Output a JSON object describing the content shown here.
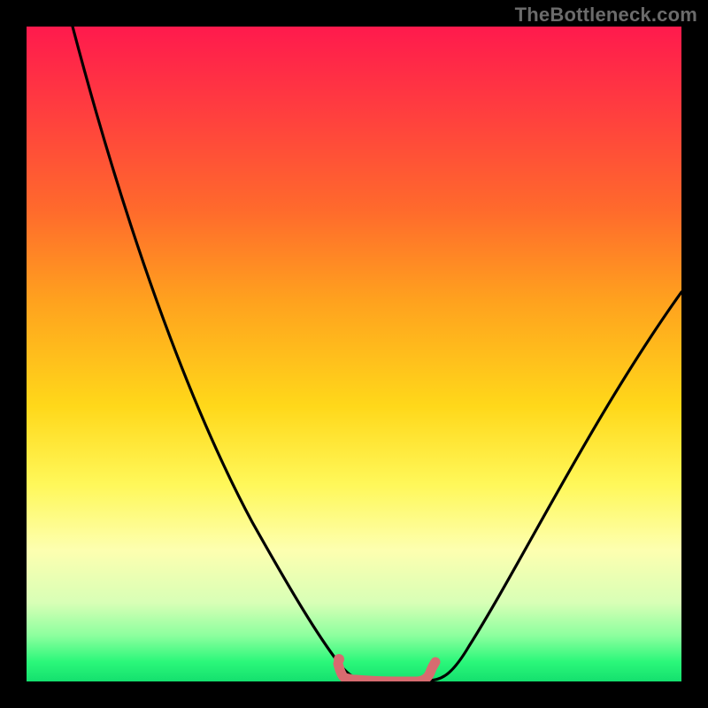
{
  "watermark": {
    "text": "TheBottleneck.com"
  },
  "colors": {
    "frame": "#000000",
    "curve": "#000000",
    "squiggle": "#d76b70",
    "gradient_stops": [
      {
        "pct": 0,
        "hex": "#ff1a4d"
      },
      {
        "pct": 12,
        "hex": "#ff3b40"
      },
      {
        "pct": 28,
        "hex": "#ff6a2c"
      },
      {
        "pct": 42,
        "hex": "#ffa21e"
      },
      {
        "pct": 58,
        "hex": "#ffd81a"
      },
      {
        "pct": 70,
        "hex": "#fff85a"
      },
      {
        "pct": 80,
        "hex": "#fdffb0"
      },
      {
        "pct": 88,
        "hex": "#d8ffb6"
      },
      {
        "pct": 93,
        "hex": "#8cff9e"
      },
      {
        "pct": 97,
        "hex": "#2bf77a"
      },
      {
        "pct": 100,
        "hex": "#14e06e"
      }
    ]
  },
  "chart_data": {
    "type": "line",
    "title": "",
    "xlabel": "",
    "ylabel": "",
    "xlim": [
      0,
      100
    ],
    "ylim": [
      0,
      100
    ],
    "note": "Bottleneck curve: y is bottleneck % as a function of component match x; minimum ~0 over x≈48–60; rises to ~100 at x=7 (left arm) and ~60 at x=100 (right arm). No numeric axis labels are shown in the image; values are read off relative plot position.",
    "series": [
      {
        "name": "bottleneck-curve",
        "x": [
          7,
          12,
          18,
          24,
          30,
          36,
          42,
          46,
          48,
          50,
          54,
          58,
          60,
          62,
          66,
          72,
          80,
          90,
          100
        ],
        "y": [
          100,
          88,
          74,
          60,
          47,
          33,
          18,
          7,
          2,
          0.5,
          0.2,
          0.3,
          1.5,
          3.5,
          9,
          18,
          30,
          45,
          60
        ]
      },
      {
        "name": "optimal-range-squiggle",
        "x": [
          48,
          49,
          50,
          51,
          53,
          55,
          57,
          58,
          59,
          60,
          61
        ],
        "y": [
          2.5,
          0.8,
          0.4,
          0.6,
          0.3,
          0.3,
          0.3,
          0.3,
          1.1,
          2.3,
          3.0
        ]
      }
    ]
  }
}
